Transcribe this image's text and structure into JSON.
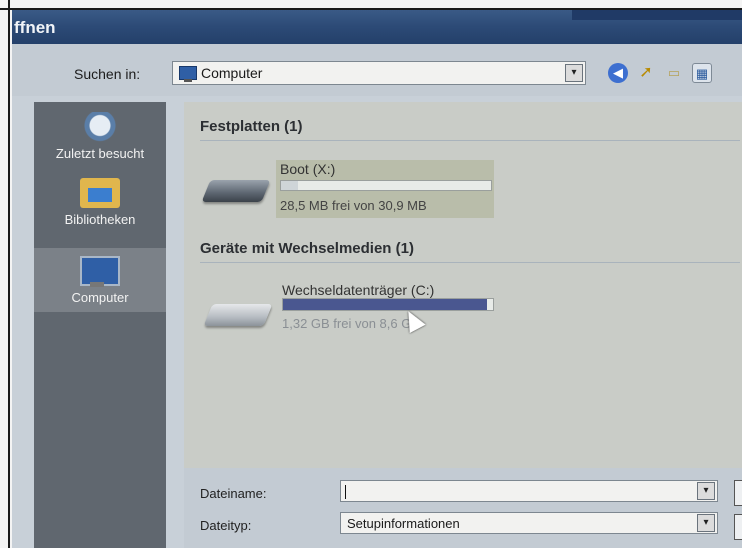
{
  "dialog": {
    "title": "ffnen"
  },
  "toolbar": {
    "lookin_label": "Suchen in:",
    "location_value": "Computer",
    "dropdown_glyph": "▾",
    "icons": [
      "computer-icon",
      "back-icon",
      "up-folder-icon",
      "new-folder-icon",
      "views-menu-icon"
    ]
  },
  "places": [
    {
      "label": "Zuletzt besucht",
      "icon": "recent-places-icon"
    },
    {
      "label": "Bibliotheken",
      "icon": "libraries-icon"
    },
    {
      "label": "Computer",
      "icon": "computer-icon",
      "selected": true
    }
  ],
  "groups": [
    {
      "header": "Festplatten (1)",
      "drives": [
        {
          "name": "Boot (X:)",
          "space_text": "28,5 MB frei von 30,9 MB",
          "used_fraction": 0.08,
          "bar_color": "#cfd5d8"
        }
      ]
    },
    {
      "header": "Geräte mit Wechselmedien (1)",
      "drives": [
        {
          "name": "Wechseldatenträger (C:)",
          "space_text": "1,32 GB frei von 8,6 GB",
          "used_fraction": 0.97,
          "bar_color": "#4a5790"
        }
      ]
    }
  ],
  "footer": {
    "filename_label": "Dateiname:",
    "filename_value": "",
    "filetype_label": "Dateityp:",
    "filetype_value": "Setupinformationen"
  },
  "colors": {
    "titlebar": "#2c4a76",
    "places_bg": "#60676f",
    "selection": "#4a5790"
  }
}
